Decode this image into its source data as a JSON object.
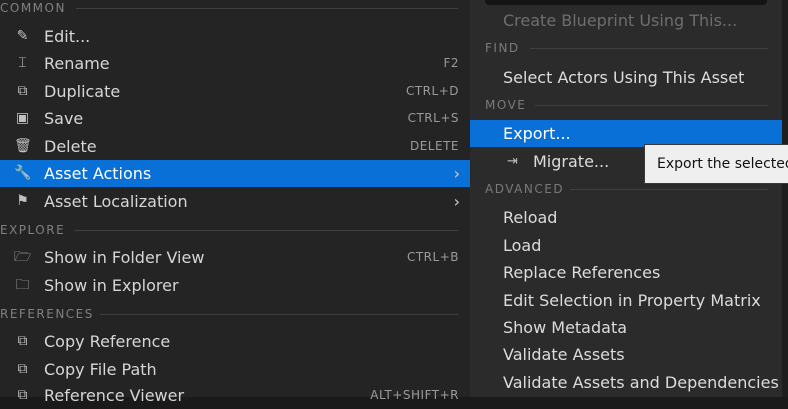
{
  "left_menu": {
    "sections": [
      {
        "title": "COMMON"
      },
      {
        "title": "EXPLORE"
      },
      {
        "title": "REFERENCES"
      }
    ],
    "items": [
      {
        "label": "Edit...",
        "icon": "pencil-icon",
        "glyph": "✎",
        "shortcut": ""
      },
      {
        "label": "Rename",
        "icon": "rename-icon",
        "glyph": "⌶",
        "shortcut": "F2"
      },
      {
        "label": "Duplicate",
        "icon": "duplicate-icon",
        "glyph": "⧉",
        "shortcut": "CTRL+D"
      },
      {
        "label": "Save",
        "icon": "save-icon",
        "glyph": "▣",
        "shortcut": "CTRL+S"
      },
      {
        "label": "Delete",
        "icon": "trash-icon",
        "glyph": "🗑",
        "shortcut": "DELETE"
      },
      {
        "label": "Asset Actions",
        "icon": "wrench-icon",
        "glyph": "🔧",
        "chevron": "›"
      },
      {
        "label": "Asset Localization",
        "icon": "flag-icon",
        "glyph": "⚑",
        "chevron": "›"
      },
      {
        "label": "Show in Folder View",
        "icon": "folder-search-icon",
        "glyph": "🗁",
        "shortcut": "CTRL+B"
      },
      {
        "label": "Show in Explorer",
        "icon": "folder-open-icon",
        "glyph": "🗀",
        "shortcut": ""
      },
      {
        "label": "Copy Reference",
        "icon": "copy-reference-icon",
        "glyph": "⧉",
        "shortcut": ""
      },
      {
        "label": "Copy File Path",
        "icon": "copy-path-icon",
        "glyph": "⧉",
        "shortcut": ""
      },
      {
        "label": "Reference Viewer",
        "icon": "reference-viewer-icon",
        "glyph": "⧉",
        "shortcut": "ALT+SHIFT+R"
      }
    ]
  },
  "right_menu": {
    "create_blueprint": "Create Blueprint Using This...",
    "headers": {
      "find": "FIND",
      "move": "MOVE",
      "advanced": "ADVANCED"
    },
    "select_actors": "Select Actors Using This Asset",
    "export": "Export...",
    "migrate": "Migrate...",
    "advanced_items": [
      "Reload",
      "Load",
      "Replace References",
      "Edit Selection in Property Matrix",
      "Show Metadata",
      "Validate Assets",
      "Validate Assets and Dependencies"
    ]
  },
  "tooltip": {
    "text": "Export the selected"
  },
  "colors": {
    "selected": "#0870d6",
    "menu_bg": "#242424",
    "submenu_bg": "#2b2b2b"
  }
}
